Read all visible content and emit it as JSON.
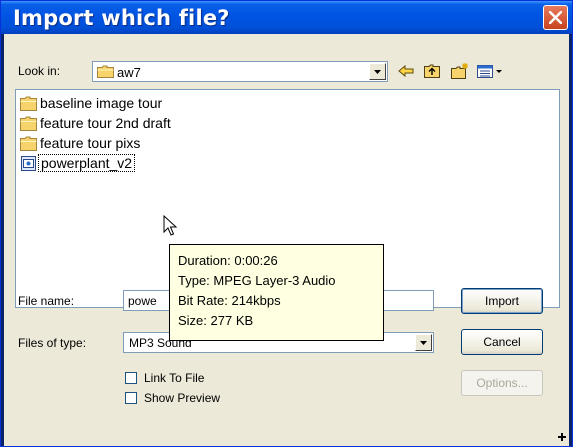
{
  "window": {
    "title": "Import which file?"
  },
  "lookin": {
    "label": "Look in:",
    "value": "aw7"
  },
  "toolbar": {
    "icons": [
      "back-arrow-icon",
      "up-one-level-icon",
      "new-folder-icon",
      "view-menu-icon"
    ]
  },
  "files": [
    {
      "name": "baseline image tour",
      "type": "folder"
    },
    {
      "name": "feature tour 2nd draft",
      "type": "folder"
    },
    {
      "name": "feature tour pixs",
      "type": "folder"
    },
    {
      "name": "powerplant_v2",
      "type": "audio",
      "selected": true
    }
  ],
  "tooltip": {
    "duration": "Duration: 0:00:26",
    "type": "Type: MPEG Layer-3 Audio",
    "bitrate": "Bit Rate: 214kbps",
    "size": "Size: 277 KB"
  },
  "filename": {
    "label": "File name:",
    "value": "powe"
  },
  "filetype": {
    "label": "Files of type:",
    "value": "MP3 Sound"
  },
  "options": {
    "link_to_file": "Link To File",
    "show_preview": "Show Preview"
  },
  "buttons": {
    "import": "Import",
    "cancel": "Cancel",
    "options": "Options..."
  },
  "colors": {
    "titlebar": "#0054e3",
    "dialog_bg": "#ece9d8",
    "tooltip_bg": "#ffffe1",
    "close_button": "#d9532c"
  }
}
